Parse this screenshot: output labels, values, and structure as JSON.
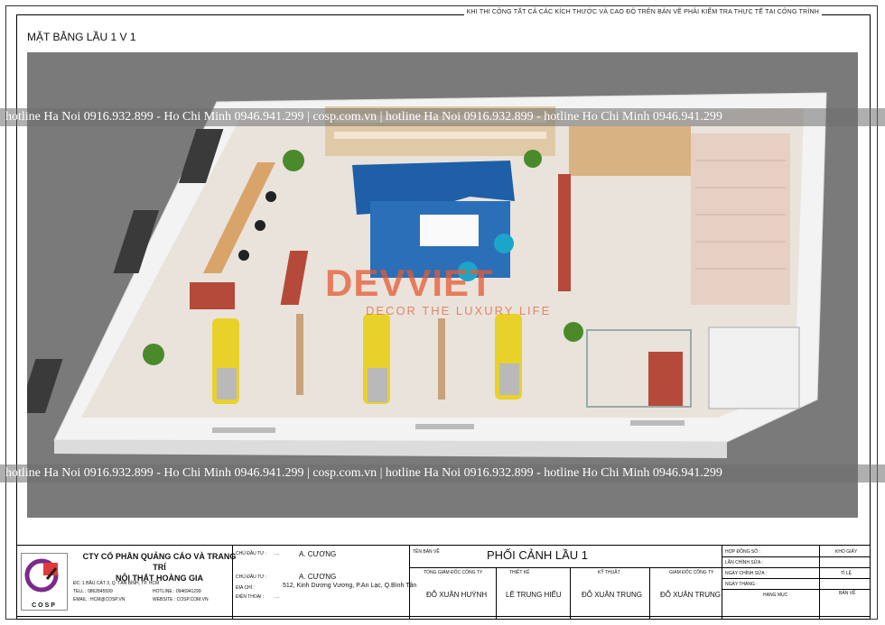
{
  "top_note": "KHI THI CÔNG TẤT CẢ CÁC KÍCH THƯỚC VÀ CAO ĐỘ TRÊN BẢN VẼ PHẢI KIỂM TRA THỰC TẾ TẠI CÔNG TRÌNH",
  "drawing_title": "MẶT BẰNG LẦU 1 V 1",
  "watermark": "hotline Ha Noi 0916.932.899 - Ho Chi Minh 0946.941.299 | cosp.com.vn | hotline Ha Noi 0916.932.899 - hotline Ho Chi Minh 0946.941.299",
  "overlay_logo": {
    "name": "DEVVIET",
    "tagline": "DECOR THE LUXURY LIFE"
  },
  "title_block": {
    "logo_text": "COSP",
    "company_line1": "CTY CỔ PHẦN QUẢNG CÁO VÀ TRANG TRÍ",
    "company_line2": "NỘI THẤT HOÀNG GIA",
    "address": "ĐC: 1 BẦU CÁT 3, Q. TÂN BÌNH, TP. HCM",
    "tel_label": "TELL :",
    "tel": "0862845599",
    "email_label": "EMAIL :",
    "email": "HCM@COSP.VN",
    "hotline_label": "HOTLINE :",
    "hotline": "0946941299",
    "website_label": "WEBSITE :",
    "website": "COSP.COM.VN",
    "investor_label": "CHỦ ĐẦU TƯ :",
    "investor_dots": "....",
    "investor": "A. CƯƠNG",
    "investor2_label": "CHỦ ĐẦU TƯ :",
    "investor2": "A. CƯƠNG",
    "location_label": "ĐỊA CHỈ :",
    "location": "512, Kinh Dương Vương, P.An Lạc, Q.Bình Tân",
    "phone_label": "ĐIỆN THOẠI :",
    "phone_dots": "....",
    "drawing_name_label": "TÊN BẢN VẼ",
    "drawing_name": "PHỐI CẢNH LẦU 1",
    "director_label": "TỔNG GIÁM ĐỐC CÔNG TY",
    "director": "ĐỖ XUÂN HUỲNH",
    "designer_label": "THIẾT KẾ",
    "designer": "LÊ TRUNG HIẾU",
    "tech_label": "KỸ THUẬT",
    "tech": "ĐỖ XUÂN TRUNG",
    "manager_label": "GIÁM ĐỐC CÔNG TY",
    "manager": "ĐỖ XUÂN TRUNG",
    "contract_label": "HỢP ĐỒNG SỐ :",
    "edit1_label": "LẦN CHỈNH SỬA :",
    "edit_date_label": "NGÀY CHỈNH SỬA :",
    "date_label": "NGÀY THÁNG :",
    "item_label": "HẠNG MỤC",
    "sheet_label": "KHỔ GIẤY",
    "scale_label": "TỈ LỆ",
    "page_label": "BẢN VẼ"
  },
  "colors": {
    "canvas": "#7a7a7a",
    "sofa": "#1f5fa8",
    "rug": "#2a6fb8",
    "chair": "#e8d22a",
    "floor": "#e9e3dc",
    "accent": "#e45a34"
  }
}
